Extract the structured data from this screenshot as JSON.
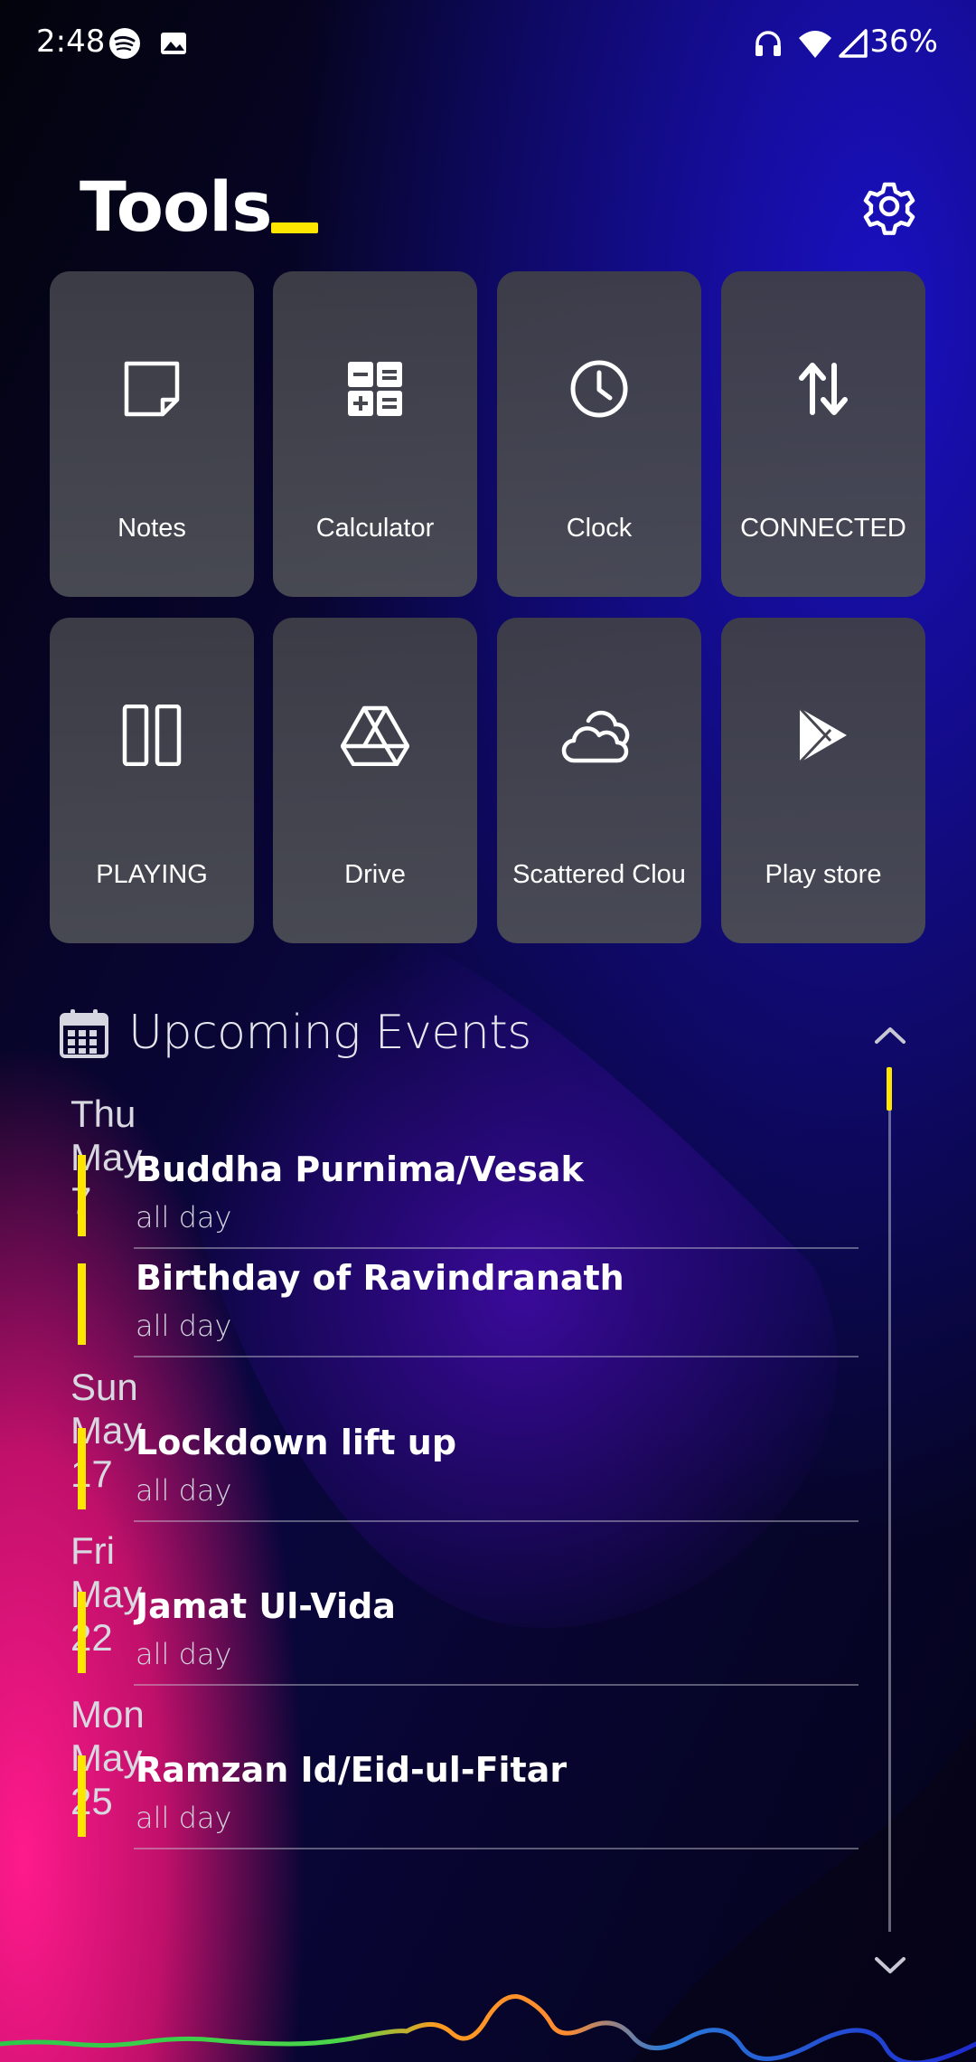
{
  "status_bar": {
    "time": "2:48",
    "battery": "36%",
    "left_icons": [
      "spotify-icon",
      "image-icon"
    ],
    "right_icons": [
      "headphones-icon",
      "wifi-icon",
      "signal-icon"
    ]
  },
  "header": {
    "title": "Tools",
    "accent_color": "#ffe600",
    "settings_icon": "gear-icon"
  },
  "tiles": [
    {
      "label": "Notes",
      "icon": "note-icon"
    },
    {
      "label": "Calculator",
      "icon": "calculator-icon"
    },
    {
      "label": "Clock",
      "icon": "clock-icon"
    },
    {
      "label": "CONNECTED",
      "icon": "data-transfer-icon"
    },
    {
      "label": "PLAYING",
      "icon": "pause-icon"
    },
    {
      "label": "Drive",
      "icon": "drive-icon"
    },
    {
      "label": "Scattered Clou",
      "icon": "cloud-icon"
    },
    {
      "label": "Play store",
      "icon": "play-store-icon"
    }
  ],
  "events": {
    "title": "Upcoming Events",
    "icon": "calendar-icon",
    "groups": [
      {
        "date": "Thu May 7",
        "items": [
          {
            "name": "Buddha Purnima/Vesak",
            "time": "all day"
          },
          {
            "name": "Birthday of Ravindranath",
            "time": "all day"
          }
        ]
      },
      {
        "date": "Sun May 17",
        "items": [
          {
            "name": "Lockdown lift up",
            "time": "all day"
          }
        ]
      },
      {
        "date": "Fri May 22",
        "items": [
          {
            "name": "Jamat Ul-Vida",
            "time": "all day"
          }
        ]
      },
      {
        "date": "Mon May 25",
        "items": [
          {
            "name": "Ramzan Id/Eid-ul-Fitar",
            "time": "all day"
          }
        ]
      }
    ]
  }
}
